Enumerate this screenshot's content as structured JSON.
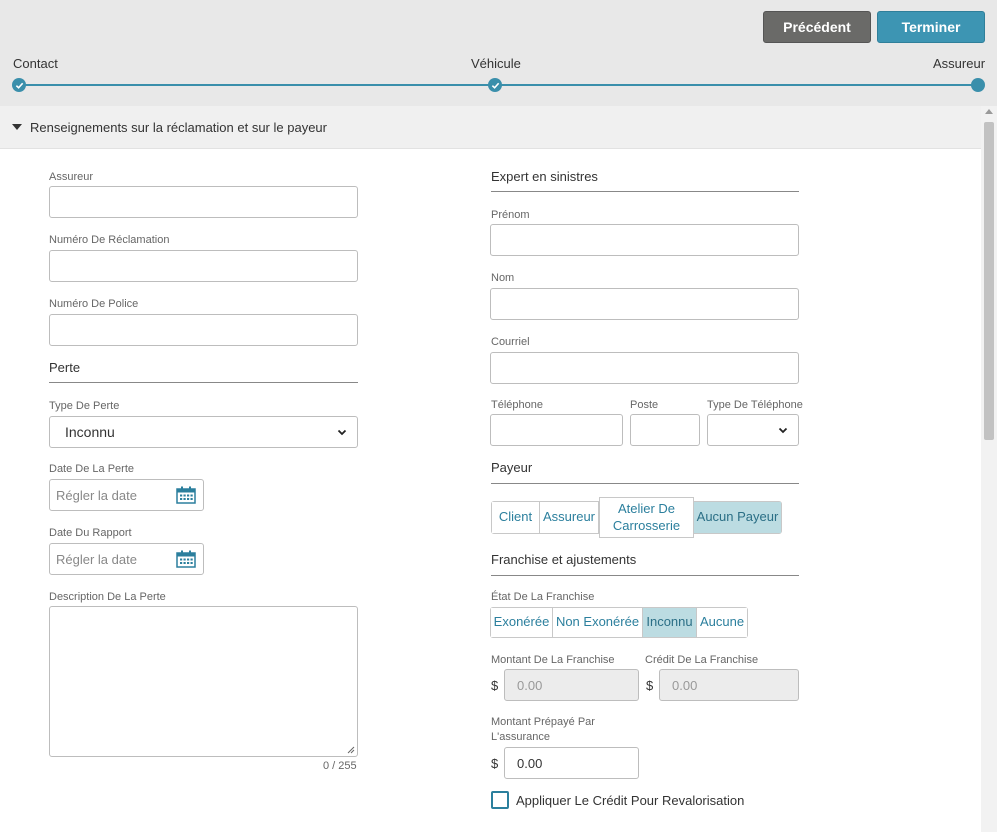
{
  "header": {
    "prev_label": "Précédent",
    "finish_label": "Terminer",
    "steps": [
      {
        "label": "Contact",
        "state": "done"
      },
      {
        "label": "Véhicule",
        "state": "done"
      },
      {
        "label": "Assureur",
        "state": "current"
      }
    ],
    "accent_color": "#3a8fab"
  },
  "section": {
    "title": "Renseignements sur la réclamation et sur le payeur"
  },
  "left": {
    "insurer_label": "Assureur",
    "insurer_value": "",
    "claim_number_label": "Numéro De Réclamation",
    "claim_number_value": "",
    "policy_number_label": "Numéro De Police",
    "policy_number_value": "",
    "loss_title": "Perte",
    "loss_type_label": "Type De Perte",
    "loss_type_value": "Inconnu",
    "loss_date_label": "Date De La Perte",
    "loss_date_placeholder": "Régler la date",
    "report_date_label": "Date Du Rapport",
    "report_date_placeholder": "Régler la date",
    "description_label": "Description De La Perte",
    "description_counter": "0 / 255"
  },
  "right": {
    "adjuster_title": "Expert en sinistres",
    "first_name_label": "Prénom",
    "last_name_label": "Nom",
    "email_label": "Courriel",
    "phone_label": "Téléphone",
    "ext_label": "Poste",
    "phone_type_label": "Type De Téléphone",
    "phone_type_value": "",
    "payer_title": "Payeur",
    "payer_options": [
      "Client",
      "Assureur",
      "Atelier De Carrosserie",
      "Aucun Payeur"
    ],
    "payer_selected": "Aucun Payeur",
    "deductible_title": "Franchise et ajustements",
    "deductible_state_label": "État De La Franchise",
    "deductible_options": [
      "Exonérée",
      "Non Exonérée",
      "Inconnu",
      "Aucune"
    ],
    "deductible_selected": "Inconnu",
    "deductible_amount_label": "Montant De La Franchise",
    "deductible_amount_value": "0.00",
    "deductible_credit_label": "Crédit De La Franchise",
    "deductible_credit_value": "0.00",
    "currency_symbol": "$",
    "prepaid_label_line1": "Montant Prépayé Par",
    "prepaid_label_line2": "L'assurance",
    "prepaid_value": "0.00",
    "apply_credit_label": "Appliquer Le Crédit Pour Revalorisation",
    "apply_credit_checked": false
  }
}
